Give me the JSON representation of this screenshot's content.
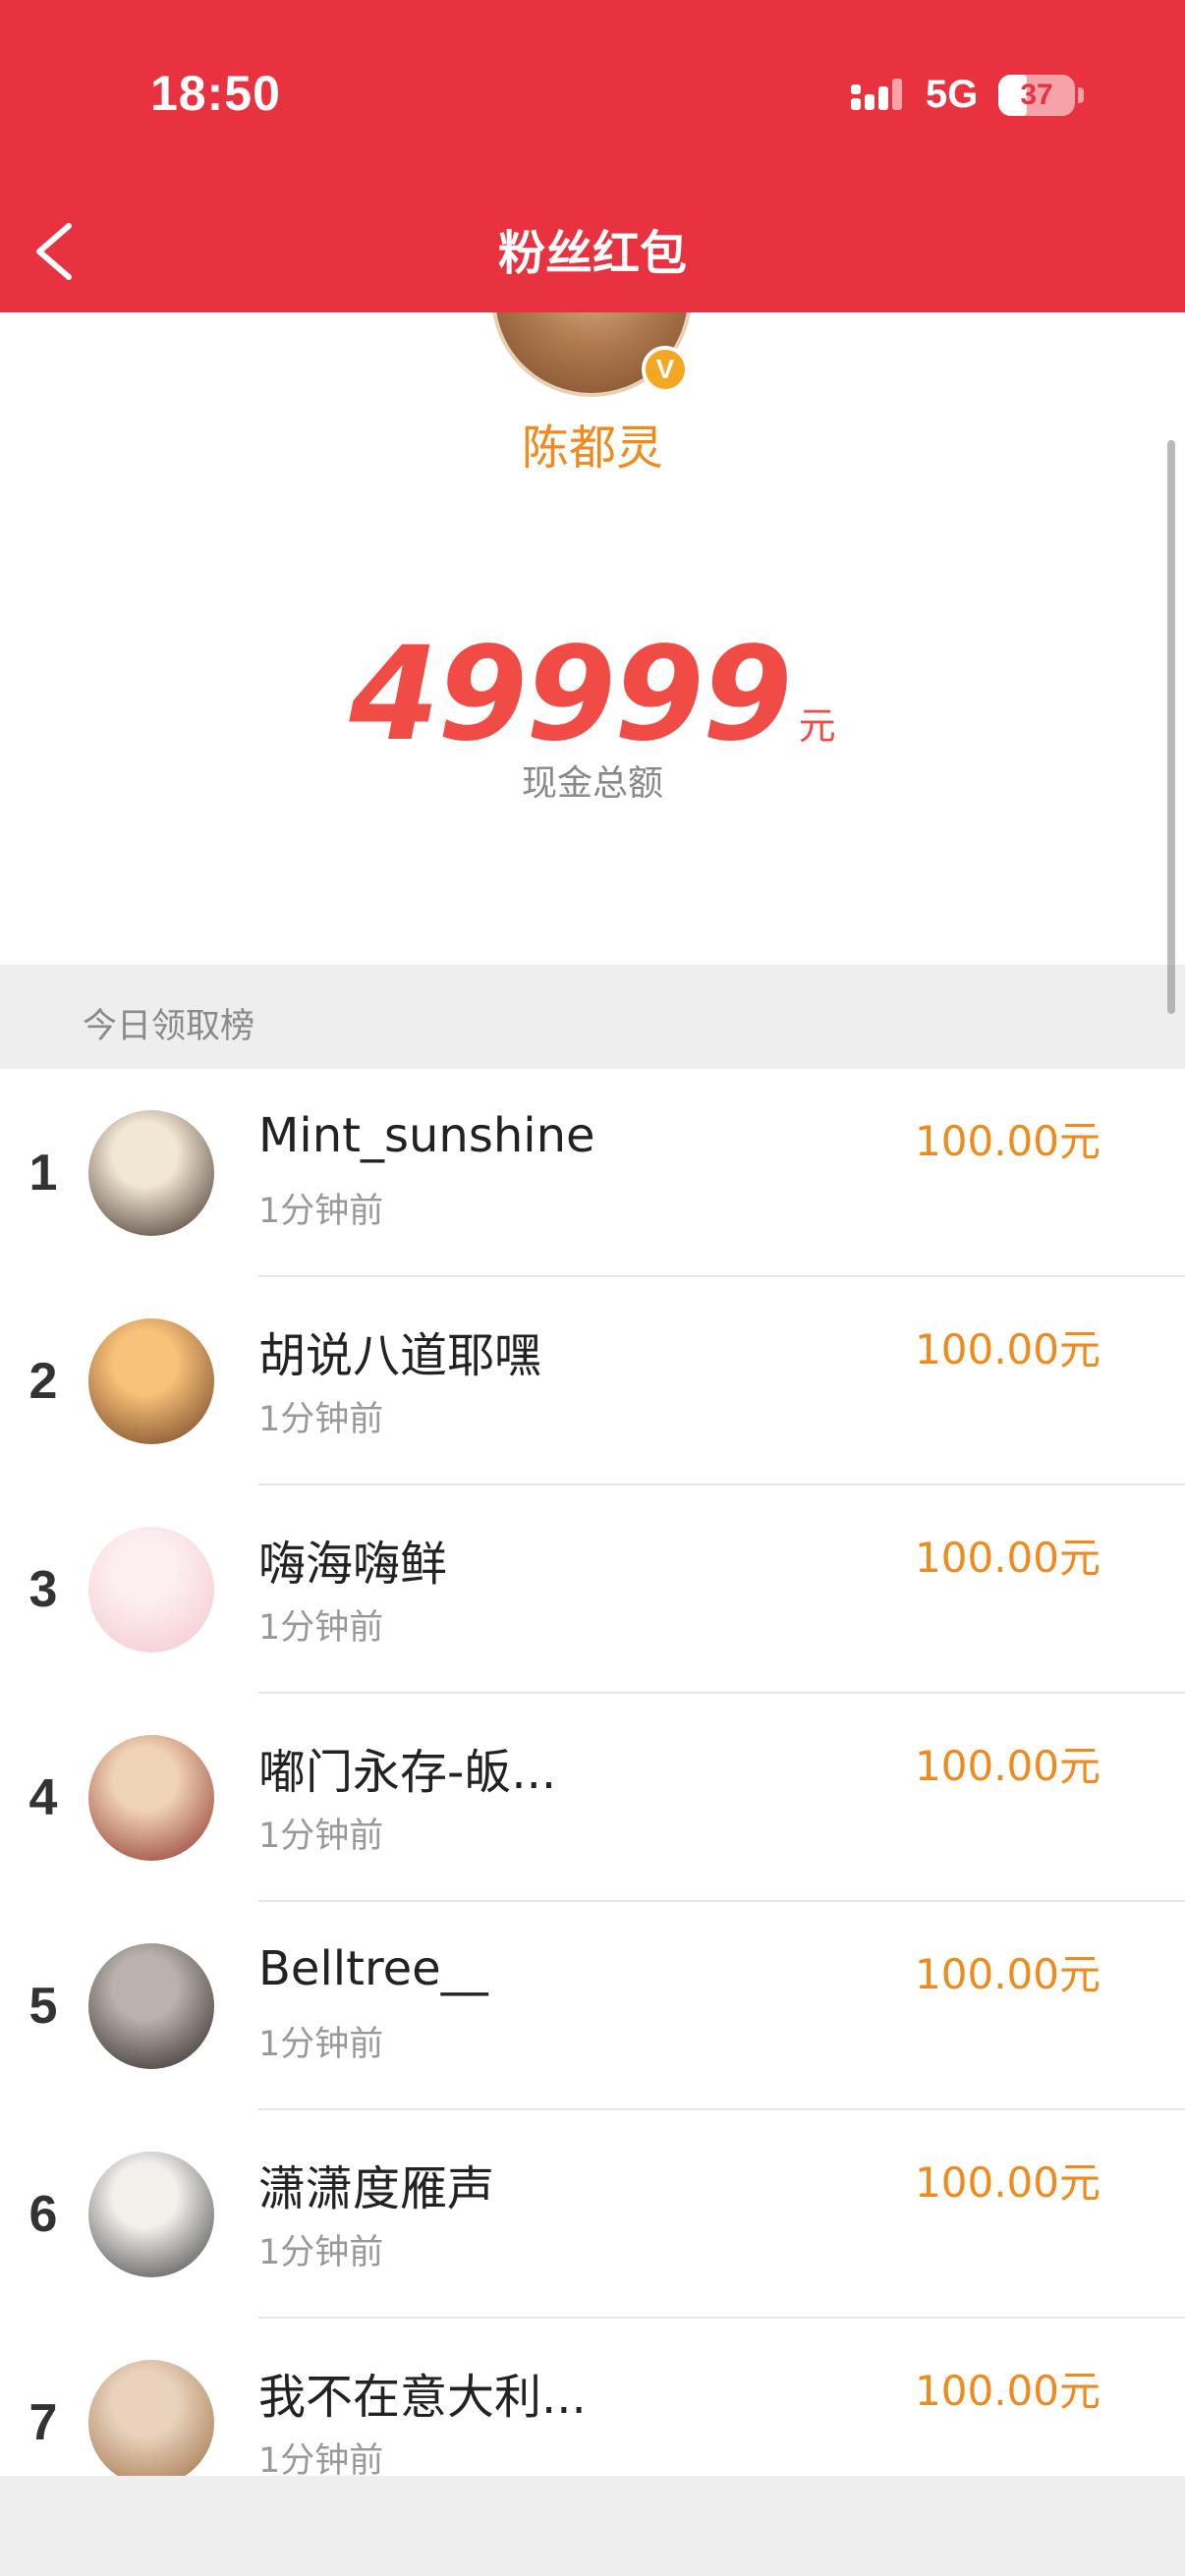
{
  "status_bar": {
    "time": "18:50",
    "network": "5G",
    "battery": "37",
    "battery_level": 0.37
  },
  "nav": {
    "title": "粉丝红包",
    "back_icon": "chevron-left-icon"
  },
  "host": {
    "name": "陈都灵",
    "verified_badge": "V"
  },
  "total": {
    "amount": "49999",
    "unit": "元",
    "label": "现金总额"
  },
  "leaderboard": {
    "title": "今日领取榜",
    "entries": [
      {
        "rank": "1",
        "name": "Mint_sunshine",
        "time": "1分钟前",
        "amount": "100.00元",
        "avatar_colors": [
          "#f2e6d4",
          "#3a2a22"
        ]
      },
      {
        "rank": "2",
        "name": "胡说八道耶嘿",
        "time": "1分钟前",
        "amount": "100.00元",
        "avatar_colors": [
          "#f7c27a",
          "#6b3a1e"
        ]
      },
      {
        "rank": "3",
        "name": "嗨海嗨鲜",
        "time": "1分钟前",
        "amount": "100.00元",
        "avatar_colors": [
          "#fdeef0",
          "#f4c6cc"
        ]
      },
      {
        "rank": "4",
        "name": "嘟门永存-皈...",
        "time": "1分钟前",
        "amount": "100.00元",
        "avatar_colors": [
          "#f0d2b4",
          "#8a2e24"
        ]
      },
      {
        "rank": "5",
        "name": "Belltree__",
        "time": "1分钟前",
        "amount": "100.00元",
        "avatar_colors": [
          "#b9b2ad",
          "#2a2220"
        ]
      },
      {
        "rank": "6",
        "name": "潇潇度雁声",
        "time": "1分钟前",
        "amount": "100.00元",
        "avatar_colors": [
          "#f3f0ec",
          "#3b3b3b"
        ]
      },
      {
        "rank": "7",
        "name": "我不在意大利...",
        "time": "1分钟前",
        "amount": "100.00元",
        "avatar_colors": [
          "#e9d3bd",
          "#9a6a3e"
        ]
      }
    ]
  },
  "colors": {
    "primary_red": "#E9323F",
    "accent_orange": "#F08A1C",
    "amount_red": "#F04B45",
    "section_bg": "#EEEEEE"
  }
}
